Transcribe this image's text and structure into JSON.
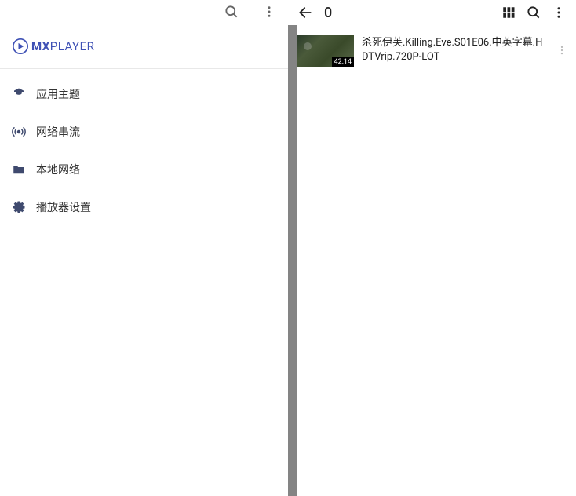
{
  "logo": {
    "bold": "MX",
    "light": "PLAYER"
  },
  "drawer": {
    "items": [
      {
        "icon": "theme",
        "label": "应用主题"
      },
      {
        "icon": "stream",
        "label": "网络串流"
      },
      {
        "icon": "network",
        "label": "本地网络"
      },
      {
        "icon": "settings",
        "label": "播放器设置"
      }
    ]
  },
  "folder": {
    "title": "0"
  },
  "videos": [
    {
      "title": "杀死伊芙.Killing.Eve.S01E06.中英字幕.HDTVrip.720P-LOT",
      "duration": "42:14"
    }
  ]
}
